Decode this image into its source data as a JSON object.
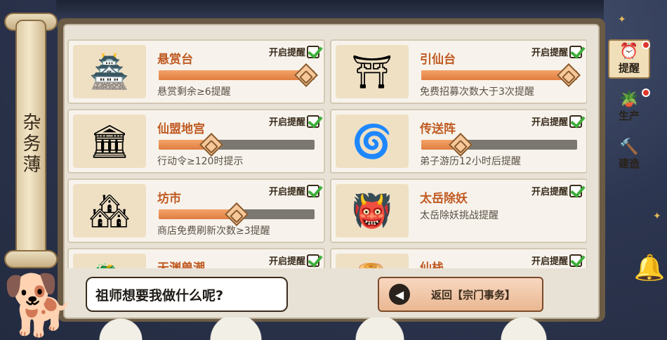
{
  "side_scroll": {
    "title": "杂务薄"
  },
  "cards": [
    {
      "name": "悬赏台",
      "toggle_label": "开启提醒",
      "enabled": true,
      "has_slider": true,
      "slider_level": 1.0,
      "description": "悬赏剩余≥6提醒",
      "thumb_icon": "pavilion-icon",
      "thumb_glyph": "🏯"
    },
    {
      "name": "引仙台",
      "toggle_label": "开启提醒",
      "enabled": true,
      "has_slider": true,
      "slider_level": 1.0,
      "description": "免费招募次数大于3次提醒",
      "thumb_icon": "altar-icon",
      "thumb_glyph": "⛩"
    },
    {
      "name": "仙盟地宫",
      "toggle_label": "开启提醒",
      "enabled": true,
      "has_slider": true,
      "slider_level": 0.34,
      "description": "行动令≥120时提示",
      "thumb_icon": "palace-gate-icon",
      "thumb_glyph": "🏛"
    },
    {
      "name": "传送阵",
      "toggle_label": "开启提醒",
      "enabled": true,
      "has_slider": true,
      "slider_level": 0.25,
      "description": "弟子游历12小时后提醒",
      "thumb_icon": "portal-icon",
      "thumb_glyph": "🌀"
    },
    {
      "name": "坊市",
      "toggle_label": "开启提醒",
      "enabled": true,
      "has_slider": true,
      "slider_level": 0.5,
      "description": "商店免费刷新次数≥3提醒",
      "thumb_icon": "market-icon",
      "thumb_glyph": "🏘"
    },
    {
      "name": "太岳除妖",
      "toggle_label": "开启提醒",
      "enabled": true,
      "has_slider": false,
      "slider_level": null,
      "description": "太岳除妖挑战提醒",
      "thumb_icon": "demon-mask-icon",
      "thumb_glyph": "👹"
    },
    {
      "name": "天渊兽潮",
      "toggle_label": "开启提醒",
      "enabled": true,
      "has_slider": false,
      "slider_level": null,
      "description": "",
      "thumb_icon": "beast-icon",
      "thumb_glyph": "🐉"
    },
    {
      "name": "仙栈",
      "toggle_label": "开启提醒",
      "enabled": true,
      "has_slider": false,
      "slider_level": null,
      "description": "",
      "thumb_icon": "plank-road-icon",
      "thumb_glyph": "🪵"
    }
  ],
  "tabs": [
    {
      "label": "提醒",
      "icon": "alarm-clock-icon",
      "glyph": "⏰",
      "active": true,
      "badge": true
    },
    {
      "label": "生产",
      "icon": "plant-pot-icon",
      "glyph": "🪴",
      "active": false,
      "badge": true
    },
    {
      "label": "建造",
      "icon": "hammer-icon",
      "glyph": "🔨",
      "active": false,
      "badge": false
    }
  ],
  "dialog": {
    "text": "祖师想要我做什么呢?"
  },
  "back_button": {
    "label": "返回【宗门事务】"
  },
  "colors": {
    "accent_orange": "#e07d3f",
    "check_green": "#3fae3b",
    "badge_red": "#e0352b"
  }
}
